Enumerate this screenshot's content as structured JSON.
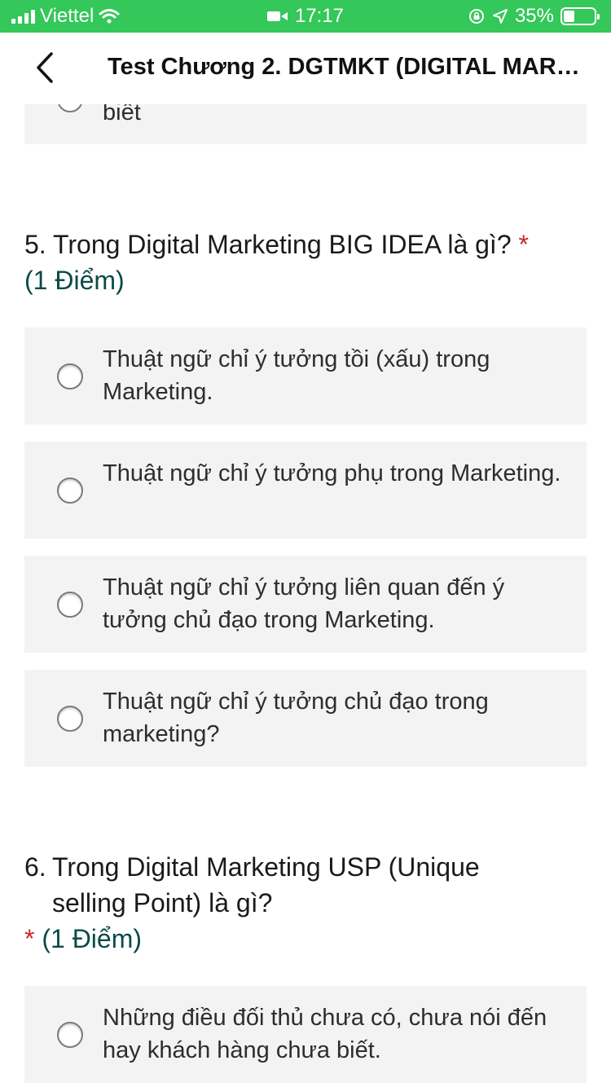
{
  "status_bar": {
    "carrier": "Viettel",
    "time": "17:17",
    "battery": "35%",
    "battery_level": 0.35
  },
  "nav": {
    "title": "Test Chương 2. DGTMKT (DIGITAL MARKETING)"
  },
  "prev_option": {
    "text": "biết"
  },
  "questions": [
    {
      "number": "5.",
      "text": "Trong Digital Marketing BIG IDEA là gì?",
      "required": "*",
      "points": "(1 Điểm)",
      "options": [
        "Thuật ngữ chỉ ý tưởng tồi (xấu) trong Marketing.",
        "Thuật ngữ chỉ ý tưởng phụ trong Marketing.",
        "Thuật ngữ chỉ ý tưởng liên quan đến ý tưởng chủ đạo trong Marketing.",
        "Thuật ngữ chỉ ý tưởng chủ đạo trong marketing?"
      ]
    },
    {
      "number": "6.",
      "text": "Trong Digital Marketing USP (Unique selling Point) là gì?",
      "required": "*",
      "points": "(1 Điểm)",
      "options": [
        "Những điều đối thủ chưa có, chưa nói đến hay khách hàng chưa biết."
      ]
    }
  ]
}
